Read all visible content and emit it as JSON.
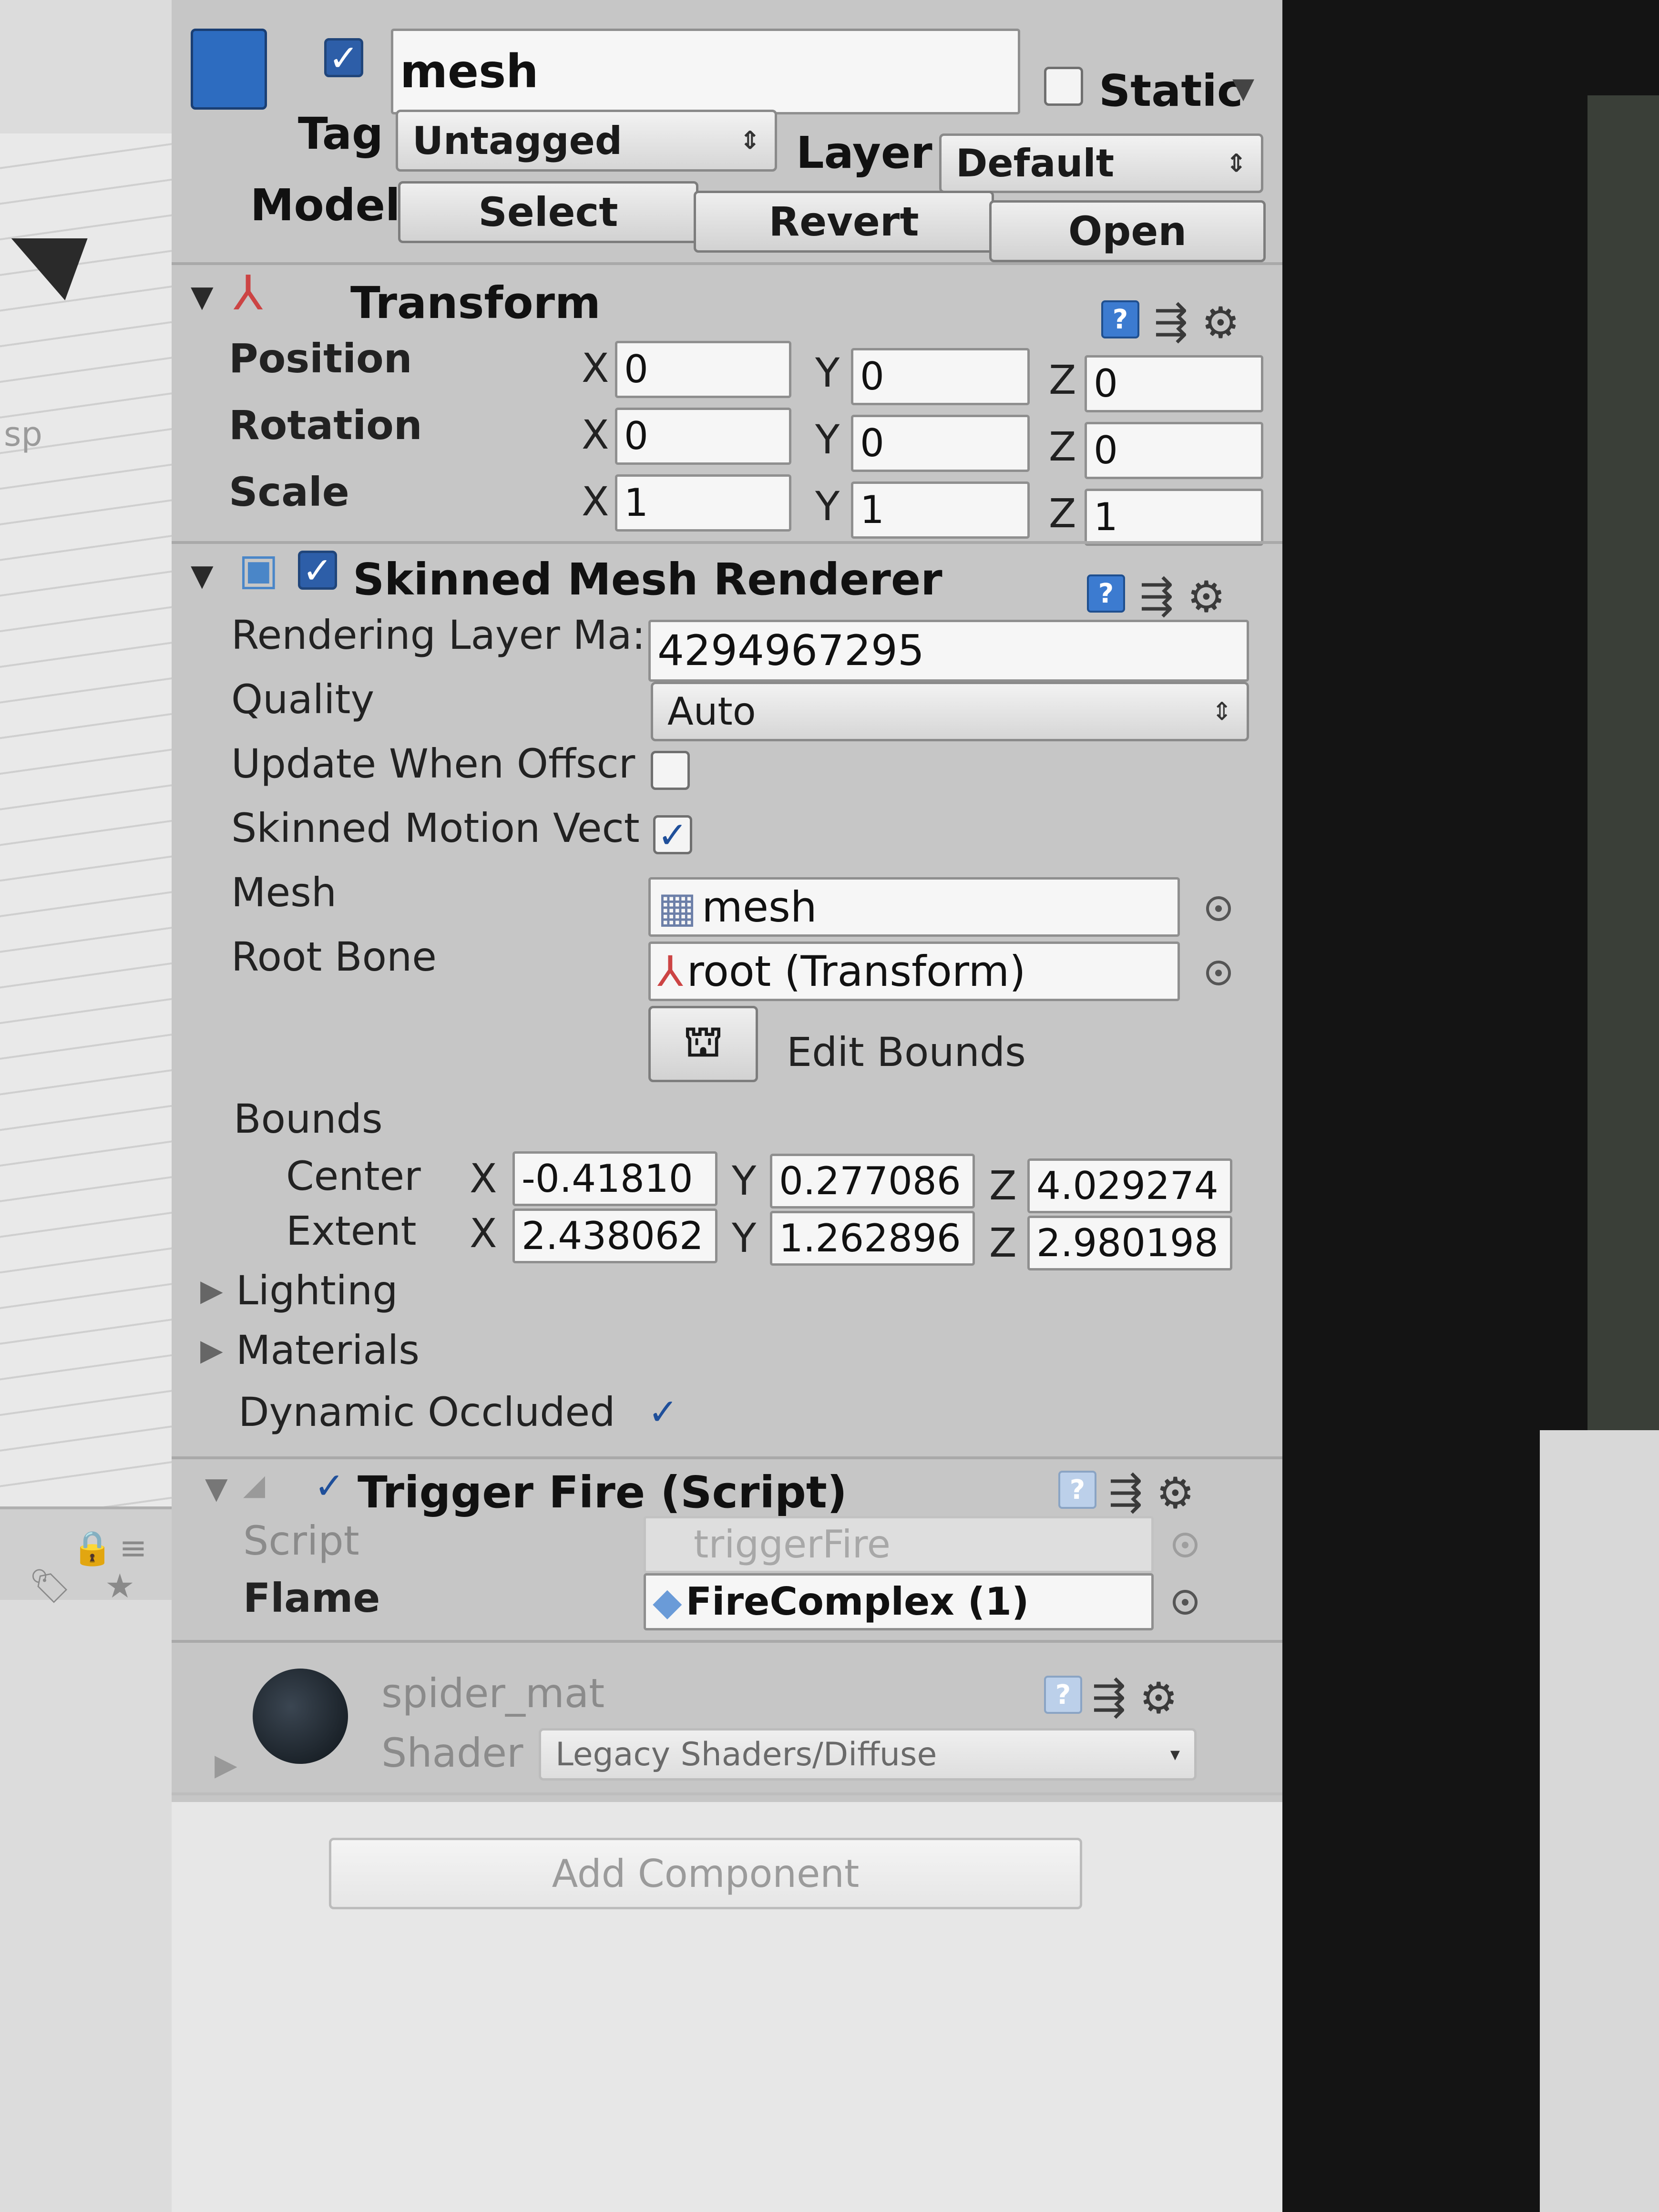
{
  "object": {
    "name": "mesh",
    "static_label": "Static",
    "static_checked": false,
    "tag_label": "Tag",
    "tag_value": "Untagged",
    "layer_label": "Layer",
    "layer_value": "Default",
    "model_label": "Model",
    "model_buttons": [
      "Select",
      "Revert",
      "Open"
    ]
  },
  "transform": {
    "title": "Transform",
    "rows": [
      {
        "label": "Position",
        "x": "0",
        "y": "0",
        "z": "0"
      },
      {
        "label": "Rotation",
        "x": "0",
        "y": "0",
        "z": "0"
      },
      {
        "label": "Scale",
        "x": "1",
        "y": "1",
        "z": "1"
      }
    ],
    "axis": {
      "x": "X",
      "y": "Y",
      "z": "Z"
    }
  },
  "skinned": {
    "title": "Skinned Mesh Renderer",
    "rendering_layer_label": "Rendering Layer Ma:",
    "rendering_layer_value": "4294967295",
    "quality_label": "Quality",
    "quality_value": "Auto",
    "update_offscreen_label": "Update When Offscr",
    "update_offscreen_checked": false,
    "skinned_motion_label": "Skinned Motion Vect",
    "skinned_motion_checked": true,
    "mesh_label": "Mesh",
    "mesh_value": "mesh",
    "root_bone_label": "Root Bone",
    "root_bone_value": "root (Transform)",
    "edit_bounds_label": "Edit Bounds",
    "bounds_label": "Bounds",
    "center_label": "Center",
    "center": {
      "x": "-0.41810",
      "y": "0.277086",
      "z": "4.029274"
    },
    "extent_label": "Extent",
    "extent": {
      "x": "2.438062",
      "y": "1.262896",
      "z": "2.980198"
    },
    "lighting_label": "Lighting",
    "materials_label": "Materials",
    "dynamic_occluded_label": "Dynamic Occluded",
    "dynamic_occluded_checked": true
  },
  "trigger": {
    "title": "Trigger Fire (Script)",
    "script_label": "Script",
    "script_value": "triggerFire",
    "flame_label": "Flame",
    "flame_value": "FireComplex (1)"
  },
  "material": {
    "name": "spider_mat",
    "shader_label": "Shader",
    "shader_value": "Legacy Shaders/Diffuse"
  },
  "add_component_label": "Add Component",
  "scene": {
    "partial_text": "sp"
  },
  "icons": {
    "help": "help-icon",
    "presets": "sliders-icon",
    "settings": "gear-icon",
    "select": "target-icon"
  },
  "colors": {
    "accent": "#2d5ea8",
    "panel": "#c6c6c6"
  }
}
